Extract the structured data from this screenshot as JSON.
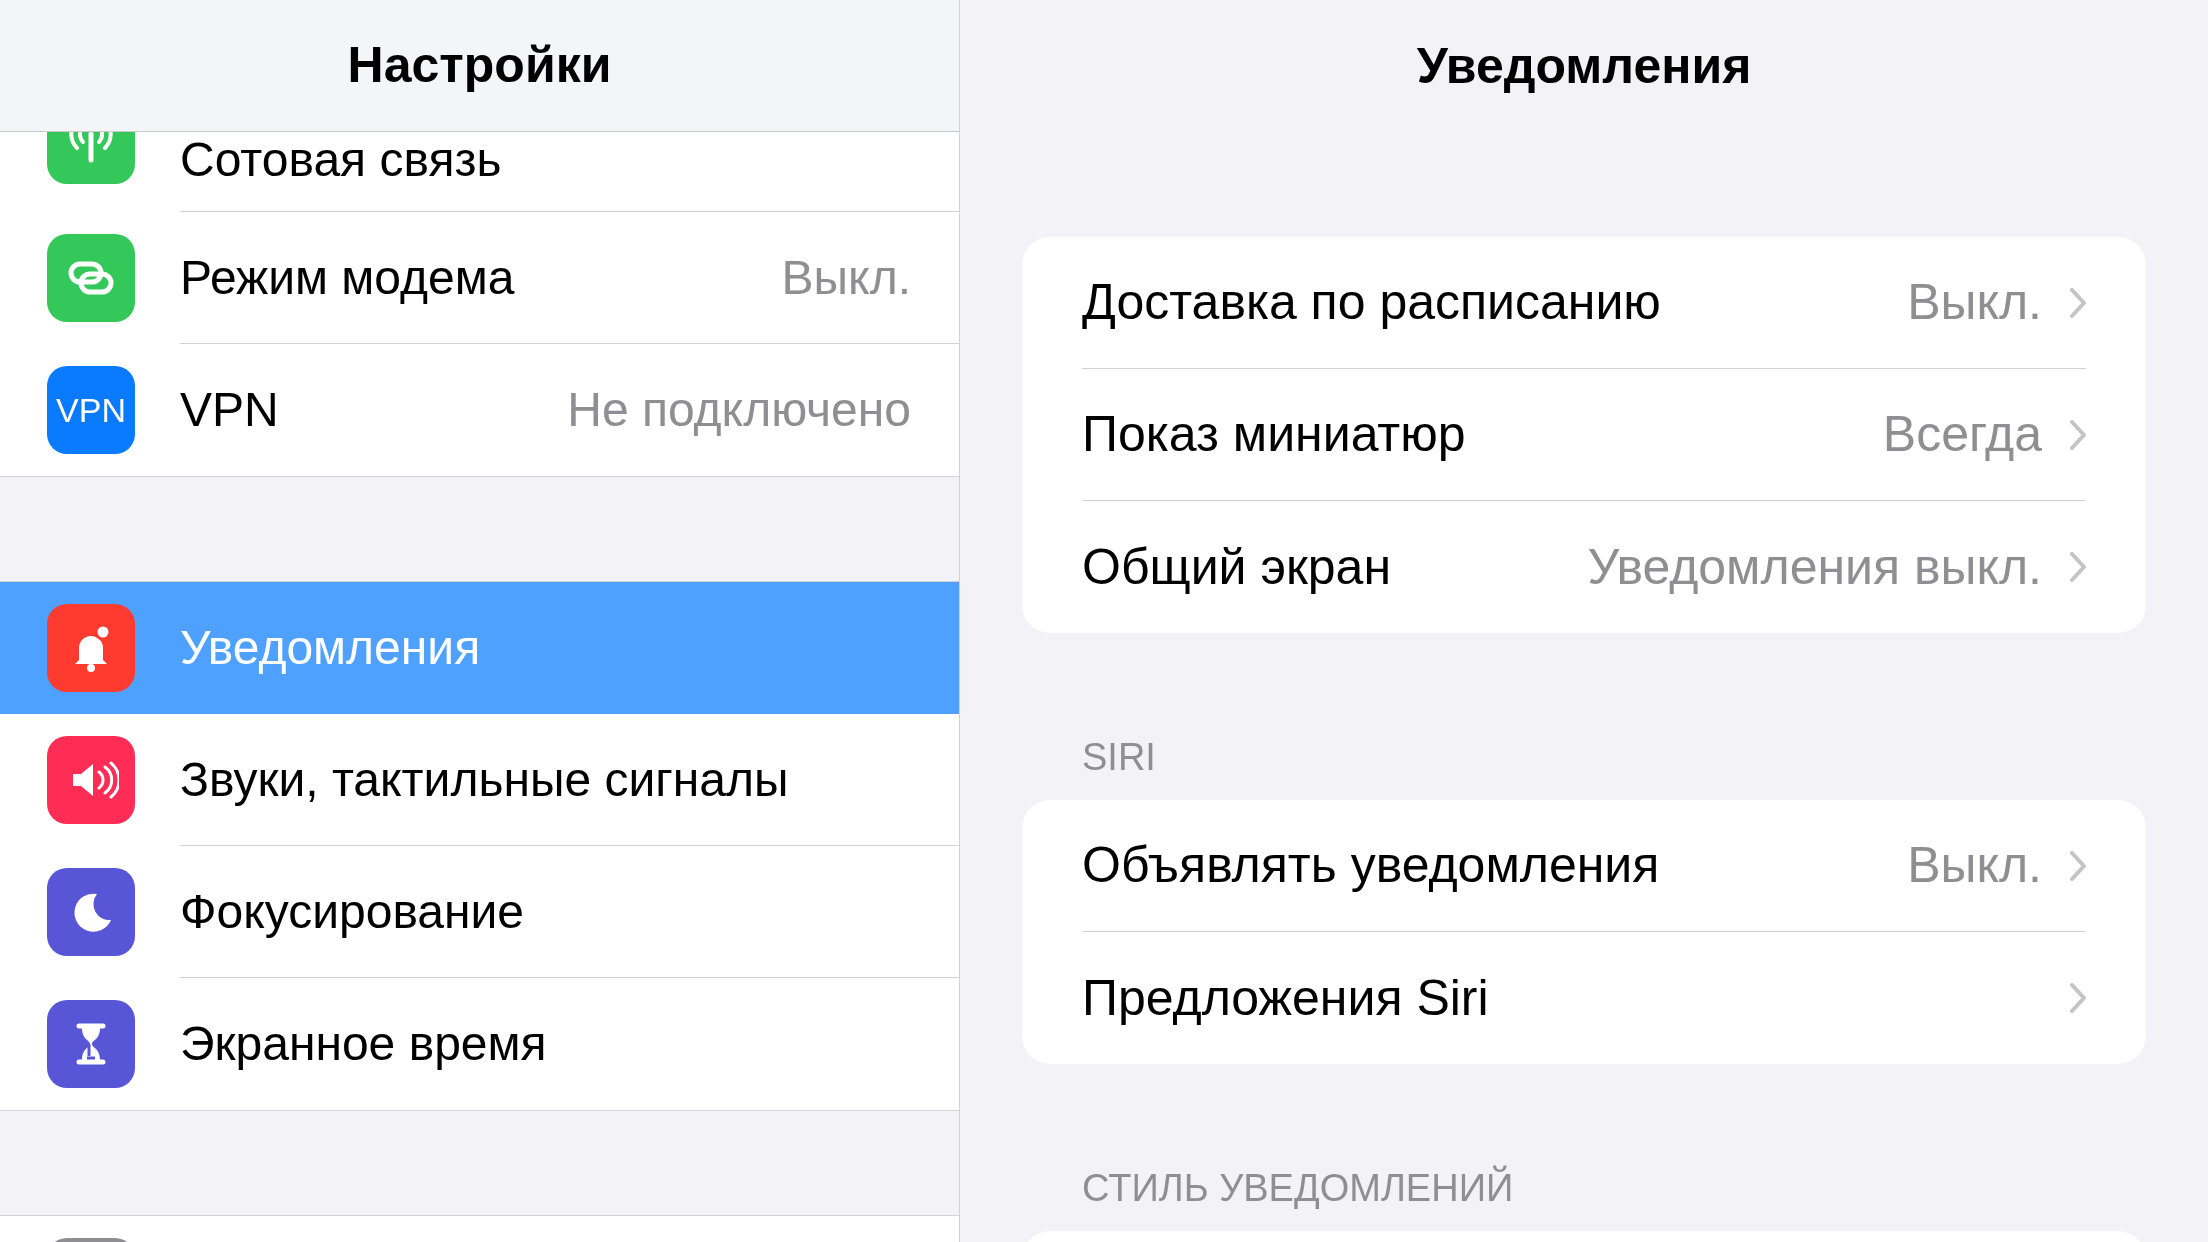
{
  "sidebar": {
    "title": "Настройки",
    "groups": [
      [
        {
          "label": "Сотовая связь",
          "color": "#34c759",
          "selected": false
        },
        {
          "label": "Режим модема",
          "value": "Выкл.",
          "color": "#34c759",
          "selected": false
        },
        {
          "label": "VPN",
          "value": "Не подключено",
          "icon_text": "VPN",
          "color": "#0a7aff",
          "selected": false
        }
      ],
      [
        {
          "label": "Уведомления",
          "color": "#ff3b30",
          "selected": true
        },
        {
          "label": "Звуки, тактильные сигналы",
          "color": "#ff2d55",
          "selected": false
        },
        {
          "label": "Фокусирование",
          "color": "#5856d6",
          "selected": false
        },
        {
          "label": "Экранное время",
          "color": "#5856d6",
          "selected": false
        }
      ]
    ]
  },
  "detail": {
    "title": "Уведомления",
    "sections": [
      {
        "rows": [
          {
            "label": "Доставка по расписанию",
            "value": "Выкл."
          },
          {
            "label": "Показ миниатюр",
            "value": "Всегда"
          },
          {
            "label": "Общий экран",
            "value": "Уведомления выкл."
          }
        ]
      },
      {
        "header": "SIRI",
        "rows": [
          {
            "label": "Объявлять уведомления",
            "value": "Выкл."
          },
          {
            "label": "Предложения Siri"
          }
        ]
      },
      {
        "header": "СТИЛЬ УВЕДОМЛЕНИЙ"
      }
    ]
  }
}
